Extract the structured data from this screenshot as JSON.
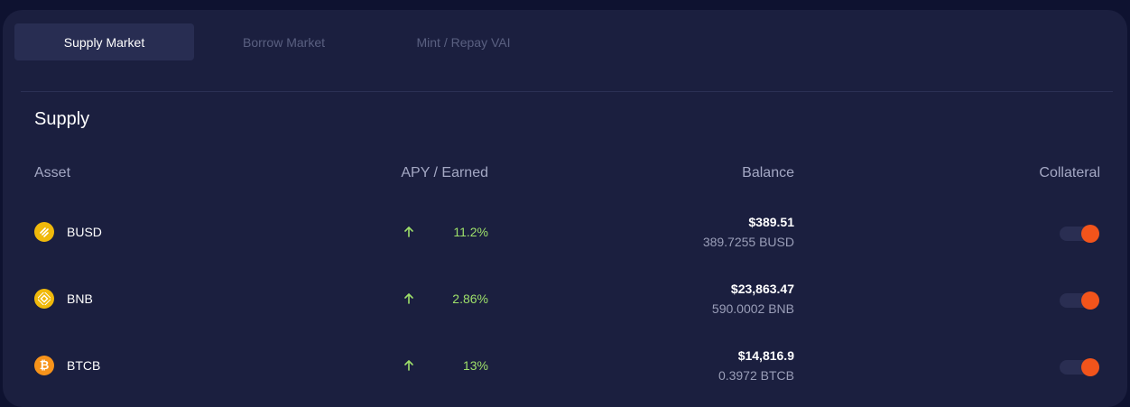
{
  "tabs": [
    {
      "label": "Supply Market",
      "active": true
    },
    {
      "label": "Borrow Market",
      "active": false
    },
    {
      "label": "Mint / Repay VAI",
      "active": false
    }
  ],
  "section_title": "Supply",
  "columns": {
    "asset": "Asset",
    "apy": "APY / Earned",
    "balance": "Balance",
    "collateral": "Collateral"
  },
  "rows": [
    {
      "asset": "BUSD",
      "icon": "busd-icon",
      "apy": "11.2%",
      "balance_usd": "$389.51",
      "balance_token": "389.7255 BUSD",
      "collateral": true
    },
    {
      "asset": "BNB",
      "icon": "bnb-icon",
      "apy": "2.86%",
      "balance_usd": "$23,863.47",
      "balance_token": "590.0002 BNB",
      "collateral": true
    },
    {
      "asset": "BTCB",
      "icon": "btcb-icon",
      "apy": "13%",
      "balance_usd": "$14,816.9",
      "balance_token": "0.3972 BTCB",
      "collateral": true
    }
  ],
  "colors": {
    "background": "#0e1230",
    "panel": "#1b1f3f",
    "active_tab": "#282d52",
    "apy_green": "#9ee06a",
    "toggle_orange": "#f2541b",
    "busd_gold": "#f0b90b",
    "btc_orange": "#f7931a"
  }
}
